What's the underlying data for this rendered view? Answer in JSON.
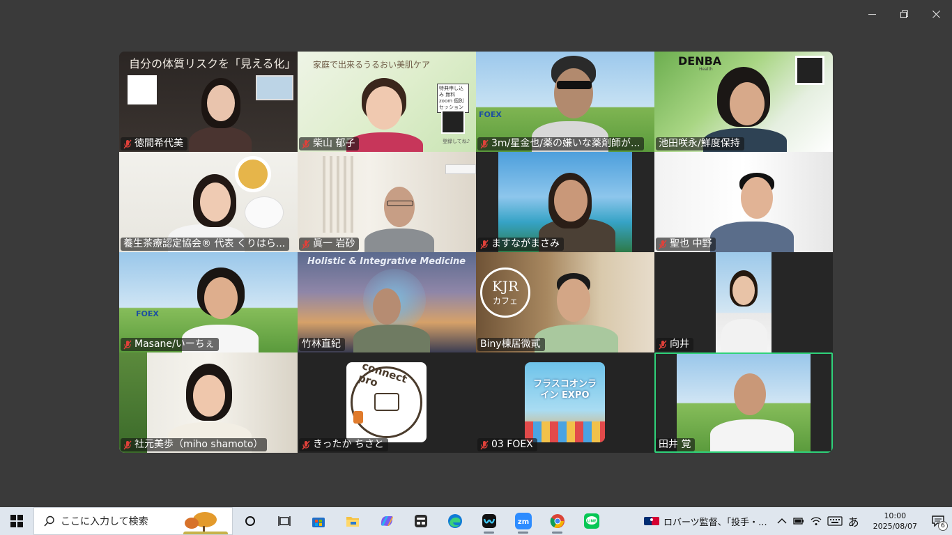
{
  "window": {
    "minimize": "minimize",
    "restore": "restore",
    "close": "close"
  },
  "participants": [
    {
      "name": "徳間希代美",
      "muted": true,
      "overlay": "自分の体質リスクを「見える化」"
    },
    {
      "name": "柴山 郁子",
      "muted": true,
      "overlay": "家庭で出来るうるおい美肌ケア",
      "overlay2": "特典申し込み 無料zoom 個別セッション",
      "overlay3": "登録してね♪"
    },
    {
      "name": "3m/星金也/薬の嫌いな薬剤師が...",
      "muted": true,
      "overlay": "FOEX"
    },
    {
      "name": "池田咲永/鮮度保持",
      "muted": false,
      "overlay": "DENBA",
      "overlay2": "Health"
    },
    {
      "name": "養生茶療認定協会® 代表 くりはら...",
      "muted": false
    },
    {
      "name": "眞一 岩砂",
      "muted": true
    },
    {
      "name": "ますながまさみ",
      "muted": true
    },
    {
      "name": "聖也 中野",
      "muted": true
    },
    {
      "name": "Masane/いーちぇ",
      "muted": true,
      "overlay": "FOEX"
    },
    {
      "name": "竹林直紀",
      "muted": false,
      "overlay": "Holistic & Integrative Medicine"
    },
    {
      "name": "Biny棟居微貳",
      "muted": false,
      "overlay": "KJR",
      "overlay2": "カフェ"
    },
    {
      "name": "向井",
      "muted": true
    },
    {
      "name": "社元美歩（miho shamoto）",
      "muted": true
    },
    {
      "name": "きったか ちさと",
      "muted": true,
      "overlay": "connect pro"
    },
    {
      "name": "03 FOEX",
      "muted": true,
      "overlay": "フラスコオンライン EXPO"
    },
    {
      "name": "田井 覚",
      "muted": false,
      "active": true
    }
  ],
  "taskbar": {
    "search_placeholder": "ここに入力して検索",
    "news": "ロバーツ監督、「投手・...",
    "ime": "あ",
    "time": "10:00",
    "date": "2025/08/07",
    "notifications": "6",
    "apps": [
      "task-view",
      "widgets",
      "store",
      "file-explorer",
      "copilot",
      "teams",
      "edge",
      "webex",
      "zoom",
      "chrome",
      "line"
    ]
  },
  "colors": {
    "active_border": "#2fd27a",
    "background": "#3a3a3a",
    "taskbar": "#dfe6ee"
  }
}
